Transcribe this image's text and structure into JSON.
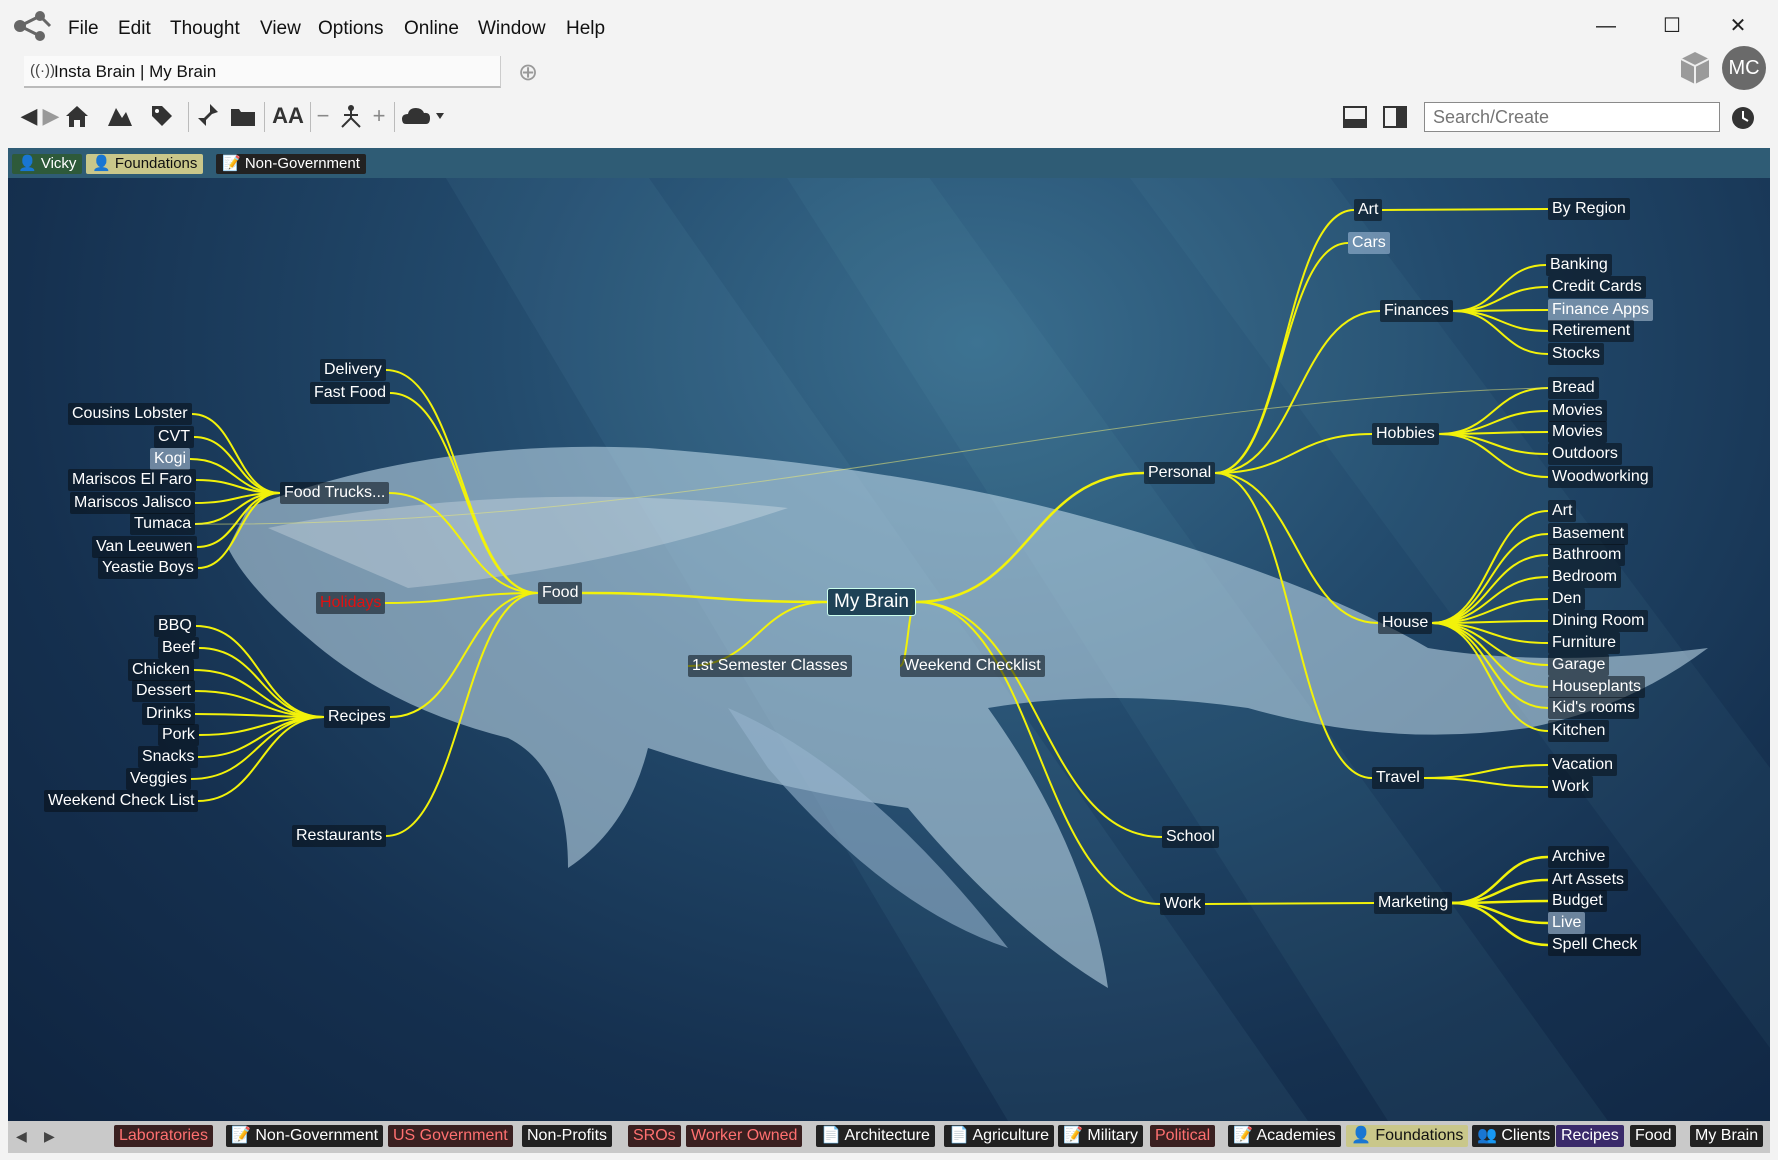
{
  "app": {
    "menu": [
      "File",
      "Edit",
      "Thought",
      "View",
      "Options",
      "Online",
      "Window",
      "Help"
    ],
    "tab_label": "Insta Brain | My Brain",
    "avatar_initials": "MC",
    "search_placeholder": "Search/Create",
    "window_controls": {
      "minimize": "—",
      "maximize": "☐",
      "close": "✕"
    }
  },
  "toolbar_icons": [
    "back-arrow-icon",
    "forward-arrow-icon",
    "home-icon",
    "types-icon",
    "tag-icon",
    "pin-icon",
    "folder-icon",
    "font-size-icon",
    "zoom-out-icon",
    "layout-icon",
    "zoom-in-icon",
    "cloud-icon"
  ],
  "pins_top": [
    {
      "label": "Vicky",
      "bg": "#2e5a3a",
      "color": "#ffffff",
      "icon": "👤"
    },
    {
      "label": "Foundations",
      "bg": "#c9c78a",
      "color": "#111111",
      "icon": "👤"
    },
    {
      "label": "Non-Government",
      "bg": "#222222",
      "color": "#ffffff",
      "icon": "📝"
    }
  ],
  "nodes": {
    "root": "My Brain",
    "food": "Food",
    "delivery": "Delivery",
    "fast_food": "Fast Food",
    "food_trucks": "Food Trucks...",
    "cousins_lobster": "Cousins Lobster",
    "cvt": "CVT",
    "kogi": "Kogi",
    "mariscos_el_faro": "Mariscos El Faro",
    "mariscos_jalisco": "Mariscos Jalisco",
    "tumaca": "Tumaca",
    "van_leeuwen": "Van Leeuwen",
    "yeastie_boys": "Yeastie Boys",
    "holidays": "Holidays",
    "bbq": "BBQ",
    "beef": "Beef",
    "chicken": "Chicken",
    "dessert": "Dessert",
    "drinks": "Drinks",
    "pork": "Pork",
    "snacks": "Snacks",
    "veggies": "Veggies",
    "weekend_check_list": "Weekend Check List",
    "recipes": "Recipes",
    "restaurants": "Restaurants",
    "first_semester": "1st Semester Classes",
    "weekend_checklist": "Weekend Checklist",
    "personal": "Personal",
    "art": "Art",
    "cars": "Cars",
    "finances": "Finances",
    "by_region": "By Region",
    "banking": "Banking",
    "credit_cards": "Credit Cards",
    "finance_apps": "Finance Apps",
    "retirement": "Retirement",
    "stocks": "Stocks",
    "hobbies": "Hobbies",
    "bread": "Bread",
    "movies1": "Movies",
    "movies2": "Movies",
    "outdoors": "Outdoors",
    "woodworking": "Woodworking",
    "house": "House",
    "h_art": "Art",
    "basement": "Basement",
    "bathroom": "Bathroom",
    "bedroom": "Bedroom",
    "den": "Den",
    "dining_room": "Dining Room",
    "furniture": "Furniture",
    "garage": "Garage",
    "houseplants": "Houseplants",
    "kids_rooms": "Kid's rooms",
    "kitchen": "Kitchen",
    "travel": "Travel",
    "vacation": "Vacation",
    "work_t": "Work",
    "school": "School",
    "work": "Work",
    "marketing": "Marketing",
    "archive": "Archive",
    "art_assets": "Art Assets",
    "budget": "Budget",
    "live": "Live",
    "spell_check": "Spell Check"
  },
  "bottom_tags": [
    {
      "label": "Laboratories",
      "bg": "#3a2020",
      "color": "#ff7070",
      "icon": ""
    },
    {
      "label": "Non-Government",
      "bg": "#222222",
      "color": "#ffffff",
      "icon": "📝"
    },
    {
      "label": "US Government",
      "bg": "#3a2020",
      "color": "#ff7070",
      "icon": ""
    },
    {
      "label": "Non-Profits",
      "bg": "#222222",
      "color": "#ffffff",
      "icon": ""
    },
    {
      "label": "SROs",
      "bg": "#3a2020",
      "color": "#ff7070",
      "icon": ""
    },
    {
      "label": "Worker Owned",
      "bg": "#3a2020",
      "color": "#ff7070",
      "icon": ""
    },
    {
      "label": "Architecture",
      "bg": "#222222",
      "color": "#ffffff",
      "icon": "📄"
    },
    {
      "label": "Agriculture",
      "bg": "#222222",
      "color": "#ffffff",
      "icon": "📄"
    },
    {
      "label": "Military",
      "bg": "#222222",
      "color": "#ffffff",
      "icon": "📝"
    },
    {
      "label": "Political",
      "bg": "#3a2020",
      "color": "#ff7070",
      "icon": ""
    },
    {
      "label": "Academies",
      "bg": "#222222",
      "color": "#ffffff",
      "icon": "📝"
    },
    {
      "label": "Foundations",
      "bg": "#c9c78a",
      "color": "#111111",
      "icon": "👤"
    },
    {
      "label": "Clients",
      "bg": "#222222",
      "color": "#ffffff",
      "icon": "👥"
    },
    {
      "label": "Recipes",
      "bg": "#3a2a6a",
      "color": "#ffffff",
      "icon": ""
    },
    {
      "label": "Food",
      "bg": "#222222",
      "color": "#ffffff",
      "icon": ""
    },
    {
      "label": "My Brain",
      "bg": "#222222",
      "color": "#ffffff",
      "icon": ""
    }
  ],
  "colors": {
    "link": "#f2f20a",
    "canvas": "#1b3a5c",
    "root_border": "#cfe8ee"
  }
}
